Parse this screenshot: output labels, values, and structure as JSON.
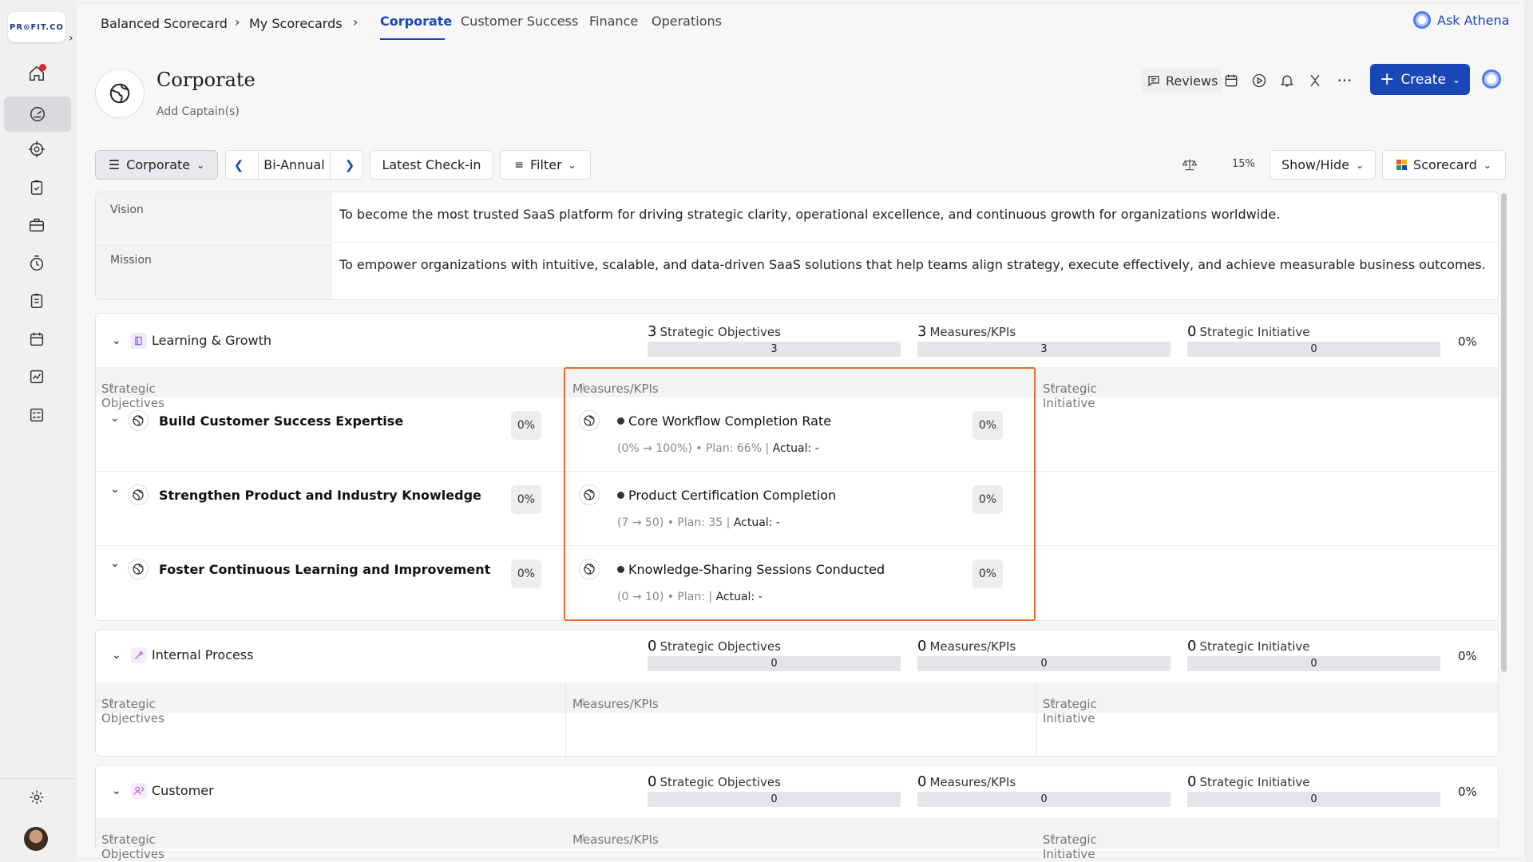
{
  "brand": {
    "logo_text": "PR⊙FIT.CO"
  },
  "breadcrumb": {
    "root": "Balanced Scorecard",
    "sep": "›",
    "second": "My Scorecards"
  },
  "tabs": [
    "Corporate",
    "Customer Success",
    "Finance",
    "Operations"
  ],
  "ask_athena": "Ask Athena",
  "header": {
    "title": "Corporate",
    "subtitle": "Add Captain(s)",
    "reviews_label": "Reviews",
    "create_label": "Create"
  },
  "toolbar": {
    "scope": "Corporate",
    "period": "Bi-Annual",
    "checkin": "Latest Check-in",
    "filter": "Filter",
    "weight_pct": "15%",
    "show_hide": "Show/Hide",
    "view": "Scorecard"
  },
  "vision": {
    "label": "Vision",
    "text": "To become the most trusted SaaS platform for driving strategic clarity, operational excellence, and continuous growth for organizations worldwide."
  },
  "mission": {
    "label": "Mission",
    "text": "To empower organizations with intuitive, scalable, and data-driven SaaS solutions that help teams align strategy, execute effectively, and achieve measurable business outcomes."
  },
  "columns": {
    "objectives": "Strategic Objectives",
    "measures": "Measures/KPIs",
    "initiatives": "Strategic Initiative"
  },
  "perspectives": [
    {
      "title": "Learning & Growth",
      "icon": "book-icon",
      "stats": {
        "objectives": {
          "num": "3",
          "label": "Strategic Objectives",
          "bar": "3"
        },
        "measures": {
          "num": "3",
          "label": "Measures/KPIs",
          "bar": "3"
        },
        "initiatives": {
          "num": "0",
          "label": "Strategic Initiative",
          "bar": "0"
        }
      },
      "pct": "0%",
      "rows": [
        {
          "objective": "Build Customer Success Expertise",
          "obj_pct": "0%",
          "kpi": "Core Workflow Completion Rate",
          "kpi_range": "(0% → 100%) • Plan: 66% | ",
          "kpi_actual": "Actual: -",
          "kpi_pct": "0%"
        },
        {
          "objective": "Strengthen Product and Industry Knowledge",
          "obj_pct": "0%",
          "kpi": "Product Certification Completion",
          "kpi_range": "(7 → 50) • Plan: 35 | ",
          "kpi_actual": "Actual: -",
          "kpi_pct": "0%"
        },
        {
          "objective": "Foster Continuous Learning and Improvement",
          "obj_pct": "0%",
          "kpi": "Knowledge-Sharing Sessions Conducted",
          "kpi_range": "(0 → 10) • Plan:  | ",
          "kpi_actual": "Actual: -",
          "kpi_pct": "0%"
        }
      ]
    },
    {
      "title": "Internal Process",
      "icon": "process-icon",
      "stats": {
        "objectives": {
          "num": "0",
          "label": "Strategic Objectives",
          "bar": "0"
        },
        "measures": {
          "num": "0",
          "label": "Measures/KPIs",
          "bar": "0"
        },
        "initiatives": {
          "num": "0",
          "label": "Strategic Initiative",
          "bar": "0"
        }
      },
      "pct": "0%"
    },
    {
      "title": "Customer",
      "icon": "customer-icon",
      "stats": {
        "objectives": {
          "num": "0",
          "label": "Strategic Objectives",
          "bar": "0"
        },
        "measures": {
          "num": "0",
          "label": "Measures/KPIs",
          "bar": "0"
        },
        "initiatives": {
          "num": "0",
          "label": "Strategic Initiative",
          "bar": "0"
        }
      },
      "pct": "0%"
    }
  ],
  "colors": {
    "accent": "#1a47b8",
    "highlight": "#f06a28",
    "notify": "#e0262b"
  }
}
